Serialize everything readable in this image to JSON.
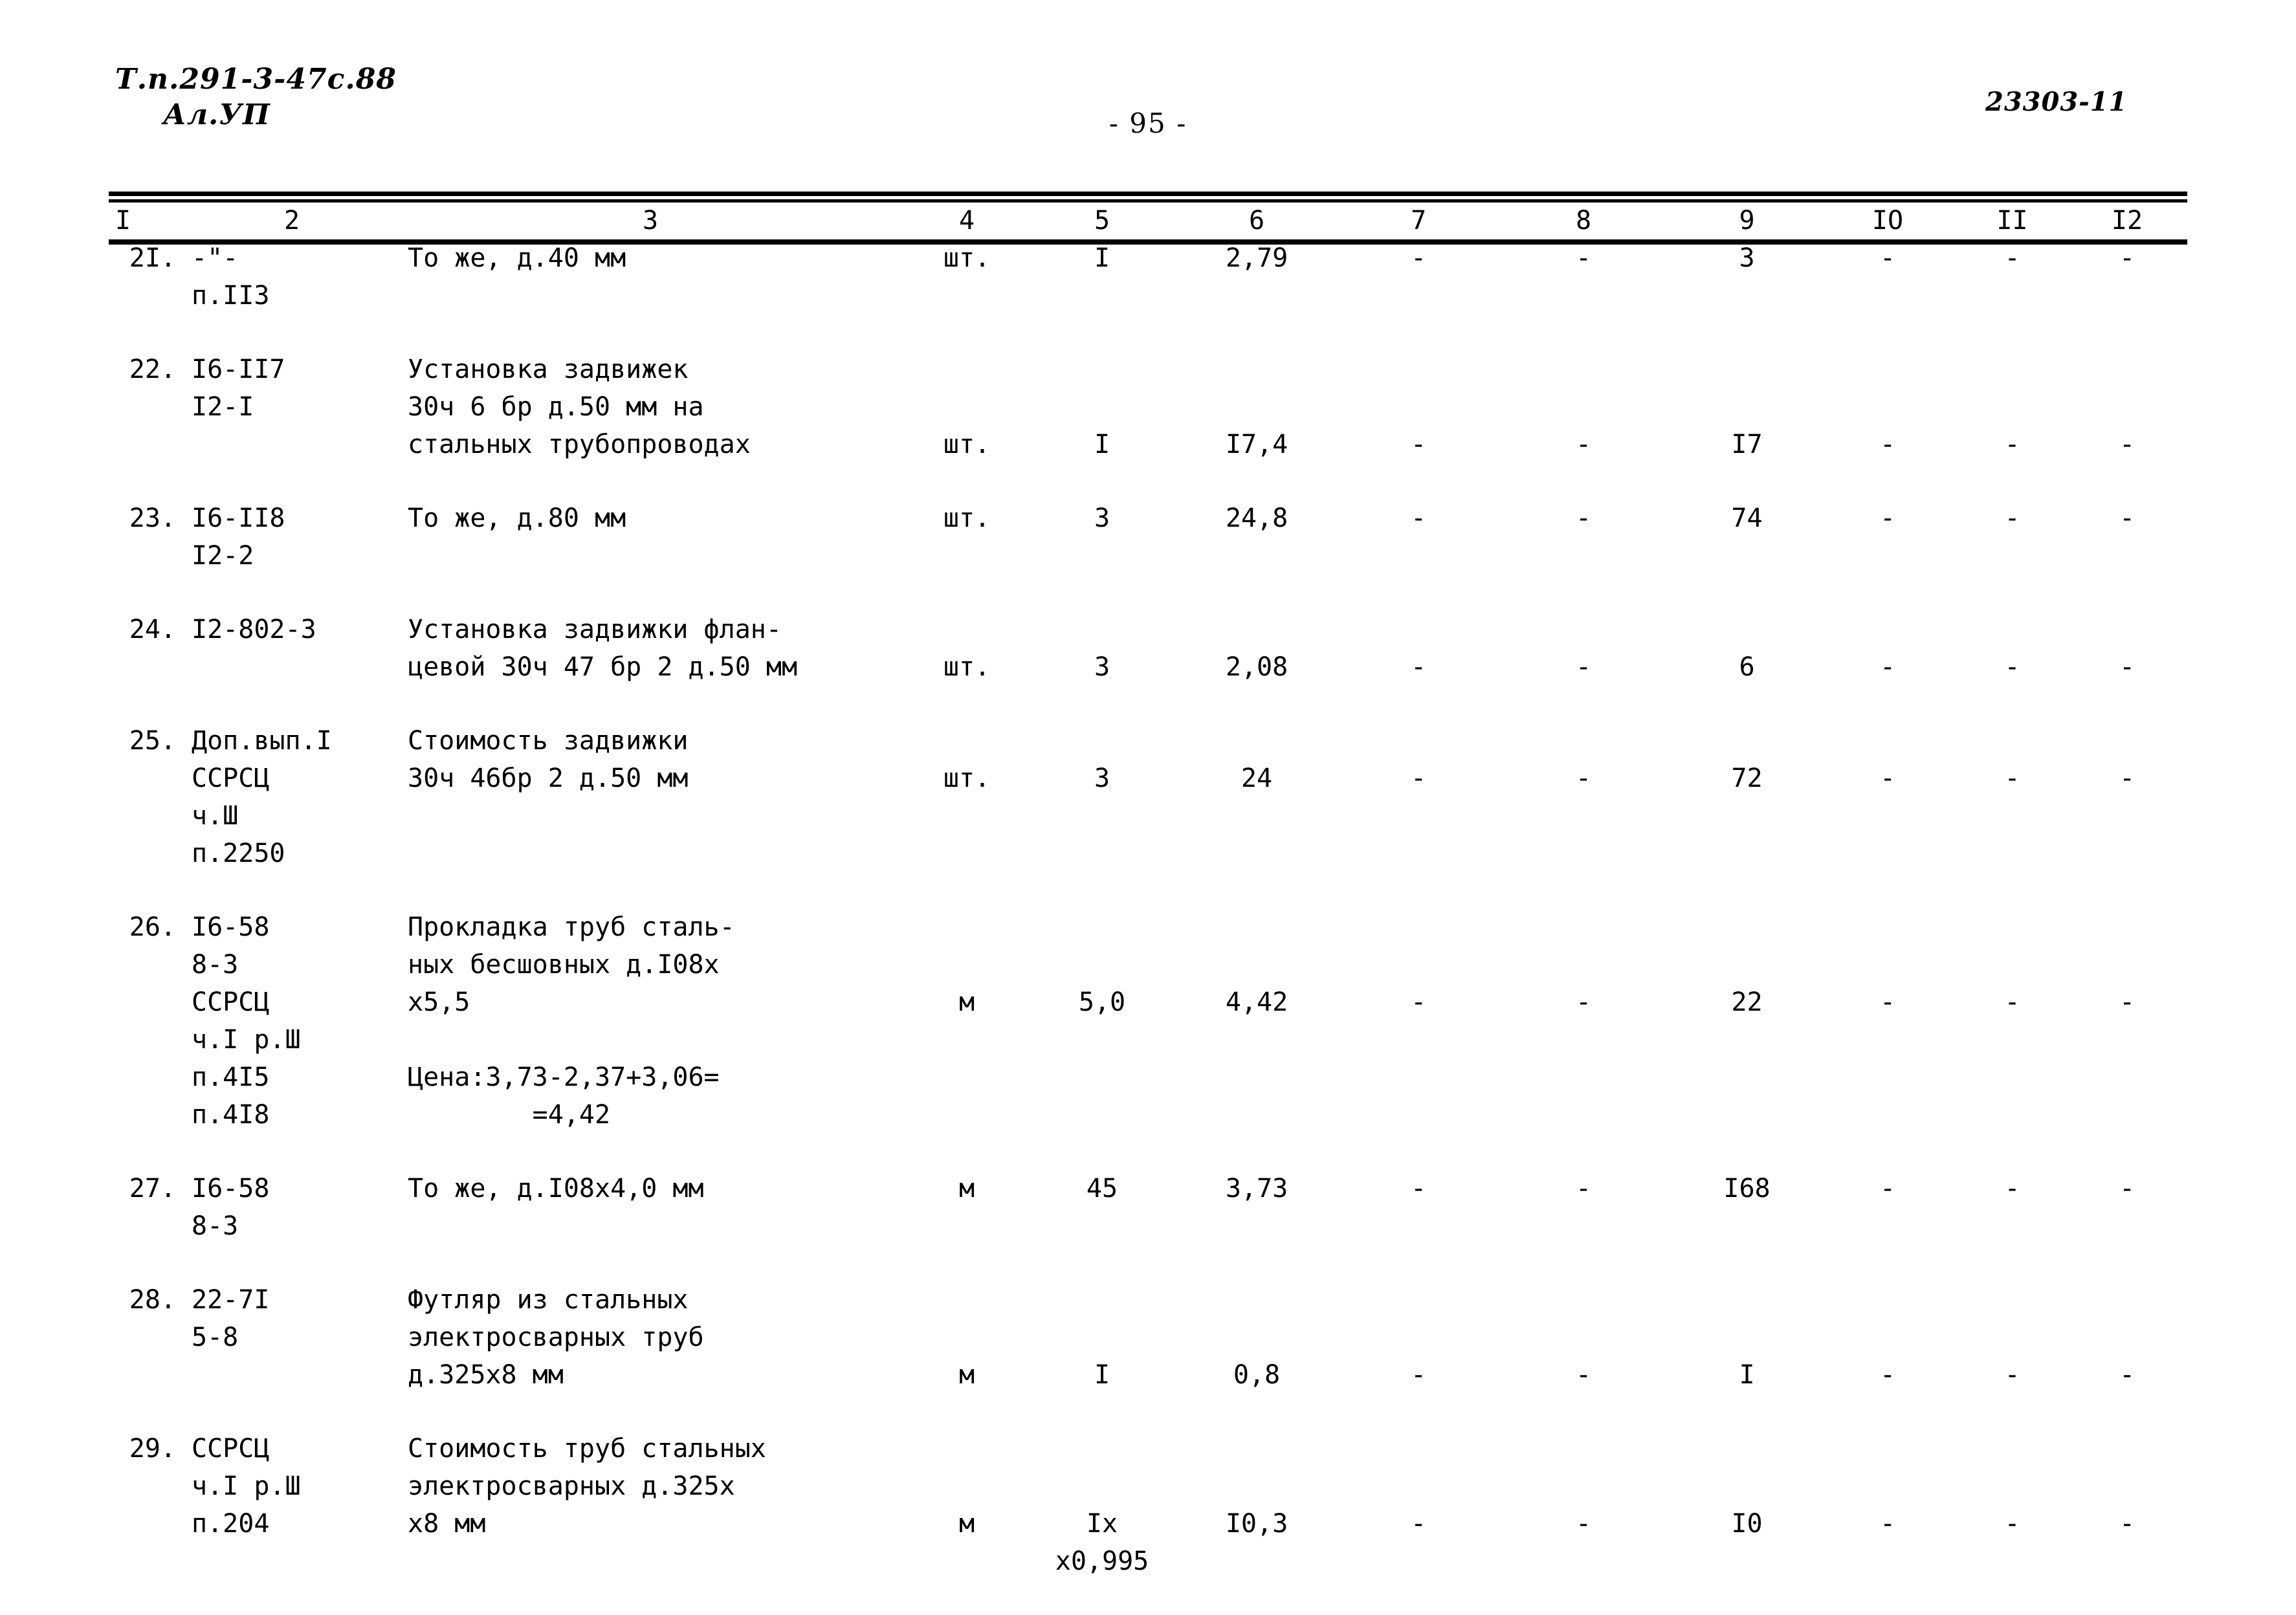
{
  "header": {
    "doc_code": "Т.п.291-3-47с.88",
    "album": "Ал.УП",
    "page_number": "- 95 -",
    "archive_code": "23303-11"
  },
  "table": {
    "column_headers": [
      "I",
      "2",
      "3",
      "4",
      "5",
      "6",
      "7",
      "8",
      "9",
      "IO",
      "II",
      "I2"
    ],
    "dash": "-",
    "rows": [
      {
        "num": "2I.",
        "code_lines": [
          "-\"-",
          "п.II3"
        ],
        "desc_lines": [
          "То же, д.40 мм"
        ],
        "unit": "шт.",
        "qty_lines": [
          "I"
        ],
        "price": "2,79",
        "col7": "-",
        "col8": "-",
        "col9": "3",
        "col10": "-",
        "col11": "-",
        "col12": "-",
        "value_offset": 0
      },
      {
        "num": "22.",
        "code_lines": [
          "I6-II7",
          "I2-I"
        ],
        "desc_lines": [
          "Установка задвижек",
          "30ч 6 бр д.50 мм на",
          "стальных трубопроводах"
        ],
        "unit": "шт.",
        "qty_lines": [
          "I"
        ],
        "price": "I7,4",
        "col7": "-",
        "col8": "-",
        "col9": "I7",
        "col10": "-",
        "col11": "-",
        "col12": "-",
        "value_offset": 2
      },
      {
        "num": "23.",
        "code_lines": [
          "I6-II8",
          "I2-2"
        ],
        "desc_lines": [
          "То же, д.80 мм"
        ],
        "unit": "шт.",
        "qty_lines": [
          "3"
        ],
        "price": "24,8",
        "col7": "-",
        "col8": "-",
        "col9": "74",
        "col10": "-",
        "col11": "-",
        "col12": "-",
        "value_offset": 0
      },
      {
        "num": "24.",
        "code_lines": [
          "I2-802-3"
        ],
        "desc_lines": [
          "Установка задвижки флан-",
          "цевой 30ч 47 бр 2 д.50 мм"
        ],
        "unit": "шт.",
        "qty_lines": [
          "3"
        ],
        "price": "2,08",
        "col7": "-",
        "col8": "-",
        "col9": "6",
        "col10": "-",
        "col11": "-",
        "col12": "-",
        "value_offset": 1
      },
      {
        "num": "25.",
        "code_lines": [
          "Доп.вып.I",
          "ССРСЦ",
          "ч.Ш",
          "п.2250"
        ],
        "desc_lines": [
          "Стоимость задвижки",
          "30ч 46бр 2 д.50 мм"
        ],
        "unit": "шт.",
        "qty_lines": [
          "3"
        ],
        "price": "24",
        "col7": "-",
        "col8": "-",
        "col9": "72",
        "col10": "-",
        "col11": "-",
        "col12": "-",
        "value_offset": 1
      },
      {
        "num": "26.",
        "code_lines": [
          "I6-58",
          "8-3",
          "ССРСЦ",
          "ч.I р.Ш",
          "п.4I5",
          "п.4I8"
        ],
        "desc_lines": [
          "Прокладка труб сталь-",
          "ных бесшовных д.I08х",
          "х5,5",
          "",
          "Цена:3,73-2,37+3,06=",
          "        =4,42"
        ],
        "unit": "м",
        "qty_lines": [
          "5,0"
        ],
        "price": "4,42",
        "col7": "-",
        "col8": "-",
        "col9": "22",
        "col10": "-",
        "col11": "-",
        "col12": "-",
        "value_offset": 2
      },
      {
        "num": "27.",
        "code_lines": [
          "I6-58",
          "8-3"
        ],
        "desc_lines": [
          "То же, д.I08х4,0 мм"
        ],
        "unit": "м",
        "qty_lines": [
          "45"
        ],
        "price": "3,73",
        "col7": "-",
        "col8": "-",
        "col9": "I68",
        "col10": "-",
        "col11": "-",
        "col12": "-",
        "value_offset": 0
      },
      {
        "num": "28.",
        "code_lines": [
          "22-7I",
          "5-8"
        ],
        "desc_lines": [
          "Футляр из стальных",
          "электросварных труб",
          "д.325х8 мм"
        ],
        "unit": "м",
        "qty_lines": [
          "I"
        ],
        "price": "0,8",
        "col7": "-",
        "col8": "-",
        "col9": "I",
        "col10": "-",
        "col11": "-",
        "col12": "-",
        "value_offset": 2
      },
      {
        "num": "29.",
        "code_lines": [
          "ССРСЦ",
          "ч.I р.Ш",
          "п.204"
        ],
        "desc_lines": [
          "Стоимость труб стальных",
          "электросварных д.325х",
          "х8 мм"
        ],
        "unit": "м",
        "qty_lines": [
          "Iх",
          "х0,995"
        ],
        "price": "I0,3",
        "col7": "-",
        "col8": "-",
        "col9": "I0",
        "col10": "-",
        "col11": "-",
        "col12": "-",
        "value_offset": 2
      }
    ]
  }
}
